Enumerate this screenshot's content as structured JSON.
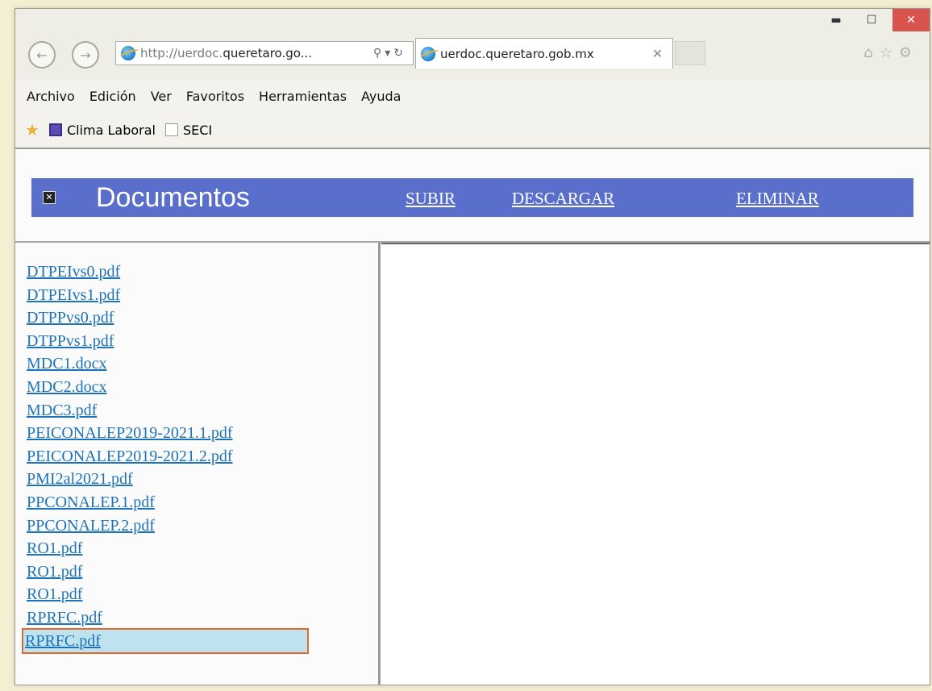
{
  "window": {
    "url_gray": "http://uerdoc.",
    "url_bold": "queretaro.go...",
    "tab_title": "uerdoc.queretaro.gob.mx"
  },
  "menu": [
    "Archivo",
    "Edición",
    "Ver",
    "Favoritos",
    "Herramientas",
    "Ayuda"
  ],
  "favorites": [
    "Clima Laboral",
    "SECI"
  ],
  "banner": {
    "title": "Documentos",
    "links": [
      "SUBIR",
      "DESCARGAR",
      "ELIMINAR"
    ],
    "color": "#5a6fcc"
  },
  "files": [
    "DTPEIvs0.pdf",
    "DTPEIvs1.pdf",
    "DTPPvs0.pdf",
    "DTPPvs1.pdf",
    "MDC1.docx",
    "MDC2.docx",
    "MDC3.pdf",
    "PEICONALEP2019-2021.1.pdf",
    "PEICONALEP2019-2021.2.pdf",
    "PMI2al2021.pdf",
    "PPCONALEP.1.pdf",
    "PPCONALEP.2.pdf",
    "RO1.pdf",
    "RO1.pdf",
    "RO1.pdf",
    "RPRFC.pdf",
    "RPRFC.pdf"
  ],
  "selected_file_index": 16,
  "icons": [
    "back-arrow-icon",
    "forward-arrow-icon",
    "ie-logo-icon",
    "search-icon",
    "refresh-icon",
    "close-icon",
    "minimize-icon",
    "maximize-icon",
    "home-icon",
    "favorites-star-icon",
    "settings-gear-icon"
  ]
}
